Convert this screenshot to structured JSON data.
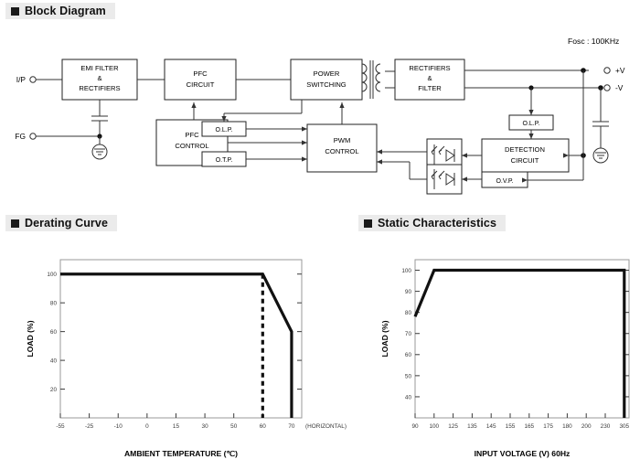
{
  "sections": {
    "block_diagram": {
      "title": "Block Diagram",
      "bullet": "square-bullet"
    },
    "derating": {
      "title": "Derating Curve",
      "bullet": "square-bullet"
    },
    "static": {
      "title": "Static Characteristics",
      "bullet": "square-bullet"
    }
  },
  "block_diagram": {
    "fosc_note": "Fosc : 100KHz",
    "input_terminals": [
      {
        "name": "input-terminal",
        "label": "I/P"
      },
      {
        "name": "fg-terminal",
        "label": "FG"
      }
    ],
    "output_terminals": [
      {
        "name": "output-terminal-positive",
        "label": "+V"
      },
      {
        "name": "output-terminal-negative",
        "label": "-V"
      }
    ],
    "blocks": [
      {
        "id": "emi-filter",
        "lines": [
          "EMI FILTER",
          "&",
          "RECTIFIERS"
        ]
      },
      {
        "id": "pfc-circuit",
        "lines": [
          "PFC",
          "CIRCUIT"
        ]
      },
      {
        "id": "power-switching",
        "lines": [
          "POWER",
          "SWITCHING"
        ]
      },
      {
        "id": "rectifiers-filter",
        "lines": [
          "RECTIFIERS",
          "&",
          "FILTER"
        ]
      },
      {
        "id": "pfc-control",
        "lines": [
          "PFC",
          "CONTROL"
        ]
      },
      {
        "id": "pwm-control",
        "lines": [
          "PWM",
          "CONTROL"
        ]
      },
      {
        "id": "detection-circuit",
        "lines": [
          "DETECTION",
          "CIRCUIT"
        ]
      },
      {
        "id": "olp-primary",
        "lines": [
          "O.L.P."
        ]
      },
      {
        "id": "otp",
        "lines": [
          "O.T.P."
        ]
      },
      {
        "id": "olp-secondary",
        "lines": [
          "O.L.P."
        ]
      },
      {
        "id": "ovp",
        "lines": [
          "O.V.P."
        ]
      }
    ],
    "components": [
      {
        "id": "transformer",
        "type": "transformer"
      },
      {
        "id": "y-capacitor-primary",
        "type": "capacitor"
      },
      {
        "id": "y-capacitor-secondary",
        "type": "capacitor"
      },
      {
        "id": "earth-ground-primary",
        "type": "ground"
      },
      {
        "id": "earth-ground-secondary",
        "type": "ground"
      },
      {
        "id": "optocoupler-feedback",
        "type": "optocoupler"
      },
      {
        "id": "optocoupler-ovp",
        "type": "optocoupler"
      }
    ]
  },
  "chart_data": [
    {
      "type": "line",
      "id": "derating-curve",
      "title": "Derating Curve",
      "xlabel": "AMBIENT TEMPERATURE (℃)",
      "ylabel": "LOAD (%)",
      "note": "(HORIZONTAL)",
      "xticks": [
        -55,
        -25,
        -10,
        0,
        15,
        30,
        50,
        60,
        70
      ],
      "xtick_labels": [
        "-55",
        "-25",
        "-10",
        "0",
        "15",
        "30",
        "50",
        "60",
        "70"
      ],
      "yticks": [
        20,
        40,
        60,
        80,
        100
      ],
      "ytick_labels": [
        "20",
        "40",
        "60",
        "80",
        "100"
      ],
      "xlim": [
        -55,
        75
      ],
      "ylim": [
        0,
        110
      ],
      "grid": false,
      "legend": "none",
      "series": [
        {
          "name": "derating",
          "style": "solid",
          "x": [
            -55,
            60,
            70,
            70
          ],
          "values": [
            100,
            100,
            60,
            0
          ]
        },
        {
          "name": "vertical-limit-60C",
          "style": "dashed",
          "x": [
            60,
            60
          ],
          "values": [
            100,
            0
          ]
        }
      ]
    },
    {
      "type": "line",
      "id": "static-characteristics",
      "title": "Static Characteristics",
      "xlabel": "INPUT VOLTAGE (V) 60Hz",
      "ylabel": "LOAD (%)",
      "xticks": [
        90,
        100,
        125,
        135,
        145,
        155,
        165,
        175,
        180,
        200,
        230,
        305
      ],
      "xtick_labels": [
        "90",
        "100",
        "125",
        "135",
        "145",
        "155",
        "165",
        "175",
        "180",
        "200",
        "230",
        "305"
      ],
      "yticks": [
        40,
        50,
        60,
        70,
        80,
        90,
        100
      ],
      "ytick_labels": [
        "40",
        "50",
        "60",
        "70",
        "80",
        "90",
        "100"
      ],
      "xlim": [
        90,
        305
      ],
      "ylim": [
        30,
        105
      ],
      "grid": false,
      "legend": "none",
      "series": [
        {
          "name": "static",
          "style": "solid",
          "x": [
            90,
            100,
            305,
            305
          ],
          "values": [
            78,
            100,
            100,
            30
          ]
        }
      ]
    }
  ]
}
